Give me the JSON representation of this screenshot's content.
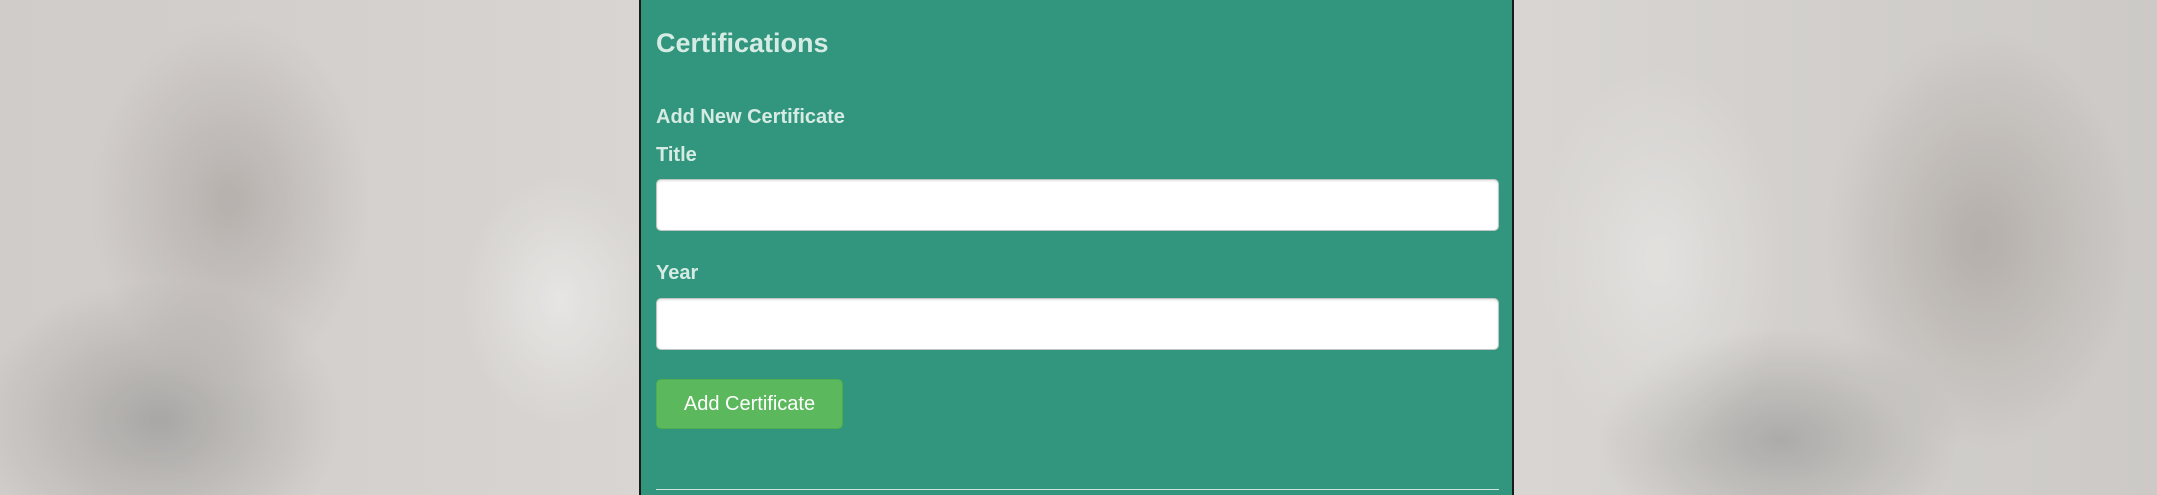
{
  "certifications": {
    "section_title": "Certifications",
    "form": {
      "heading": "Add New Certificate",
      "title_label": "Title",
      "title_value": "",
      "year_label": "Year",
      "year_value": "",
      "submit_label": "Add Certificate"
    }
  },
  "colors": {
    "panel_background": "#31967d",
    "label_text": "#d6ebe4",
    "button_background": "#5cb85c",
    "button_text": "#ffffff"
  }
}
